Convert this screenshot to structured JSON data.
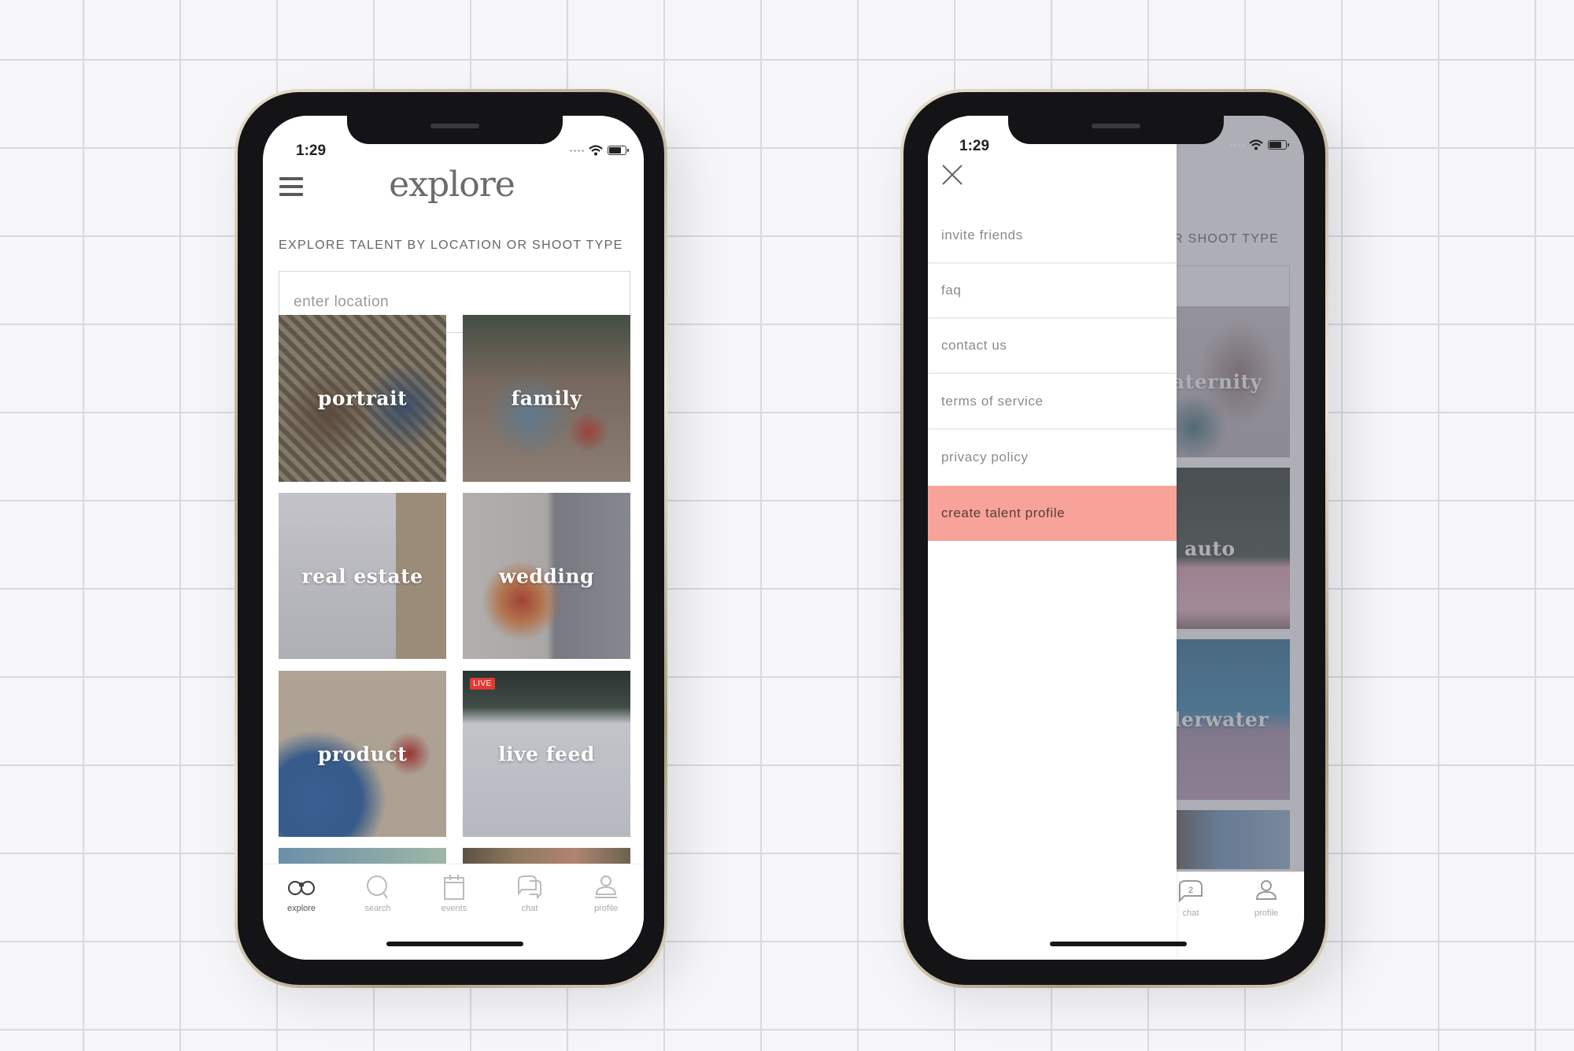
{
  "status_bar": {
    "time": "1:29"
  },
  "left_phone": {
    "header": {
      "menu_icon": "hamburger-icon",
      "title": "explore"
    },
    "section_heading": "EXPLORE TALENT BY LOCATION OR SHOOT TYPE",
    "location_input": {
      "placeholder": "enter location",
      "value": ""
    },
    "tiles": [
      {
        "label": "portrait",
        "live": false
      },
      {
        "label": "family",
        "live": false
      },
      {
        "label": "real estate",
        "live": false
      },
      {
        "label": "wedding",
        "live": false
      },
      {
        "label": "product",
        "live": false
      },
      {
        "label": "live feed",
        "live": true,
        "badge": "LIVE"
      }
    ],
    "bottom_nav": [
      {
        "label": "explore",
        "icon": "binoculars-icon",
        "active": true
      },
      {
        "label": "search",
        "icon": "search-icon",
        "active": false
      },
      {
        "label": "events",
        "icon": "calendar-icon",
        "active": false
      },
      {
        "label": "chat",
        "icon": "chat-icon",
        "active": false
      },
      {
        "label": "profile",
        "icon": "profile-icon",
        "active": false
      }
    ]
  },
  "right_phone": {
    "close_icon": "close-icon",
    "menu_items": [
      {
        "label": "invite friends"
      },
      {
        "label": "faq"
      },
      {
        "label": "contact us"
      },
      {
        "label": "terms of service"
      },
      {
        "label": "privacy policy"
      },
      {
        "label": "create talent profile",
        "highlight": true
      }
    ],
    "background_screen": {
      "heading_fragment": "R SHOOT TYPE",
      "tile_label_fragments": [
        "aternity",
        "auto",
        "lerwater"
      ],
      "nav_labels": [
        "chat",
        "profile"
      ],
      "chat_badge": "2"
    }
  },
  "colors": {
    "cta_background": "#f7a39a",
    "live_badge": "#e03a34",
    "grid_background": "#f6f6f8"
  }
}
